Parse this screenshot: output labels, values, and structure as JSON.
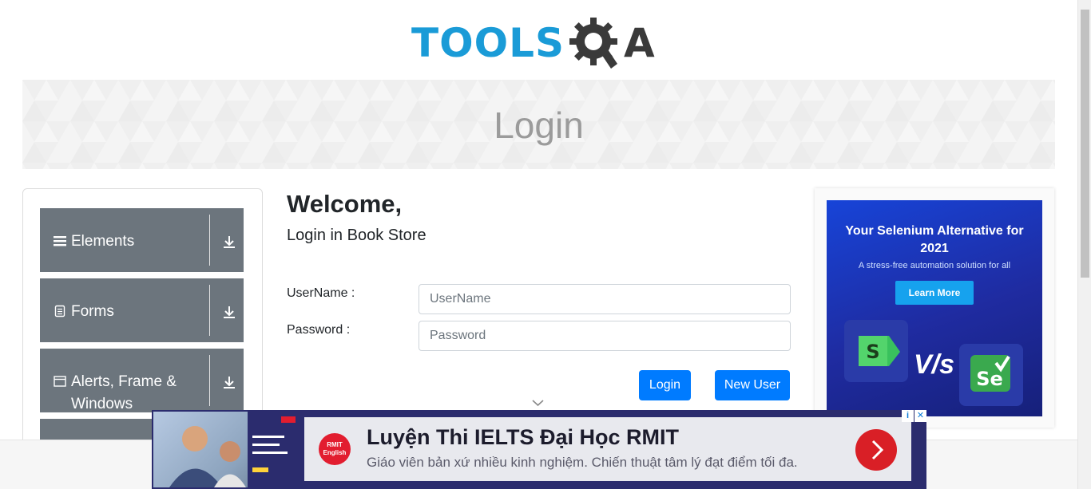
{
  "logo": {
    "text_tools": "TOOLS",
    "text_a": "A"
  },
  "banner": {
    "title": "Login"
  },
  "sidebar": {
    "groups": [
      {
        "label": "Elements",
        "icon": "menu-icon"
      },
      {
        "label": "Forms",
        "icon": "document-icon"
      },
      {
        "label": "Alerts, Frame & Windows",
        "icon": "window-icon"
      }
    ]
  },
  "main": {
    "welcome": "Welcome,",
    "subtitle": "Login in Book Store",
    "username_label": "UserName :",
    "username_placeholder": "UserName",
    "password_label": "Password :",
    "password_placeholder": "Password",
    "login_button": "Login",
    "new_user_button": "New User"
  },
  "ad_right": {
    "headline": "Your Selenium Alternative for 2021",
    "tagline": "A stress-free automation solution for all",
    "cta": "Learn More",
    "vs": "V/s"
  },
  "ad_bottom": {
    "brand": "RMIT English",
    "headline": "Luyện Thi IELTS Đại Học RMIT",
    "body": "Giáo viên bản xứ nhiều kinh nghiệm. Chiến thuật tâm lý đạt điểm tối đa."
  },
  "colors": {
    "brand_blue": "#1a9bd7",
    "sidebar_gray": "#6c757d",
    "button_blue": "#007bff"
  }
}
